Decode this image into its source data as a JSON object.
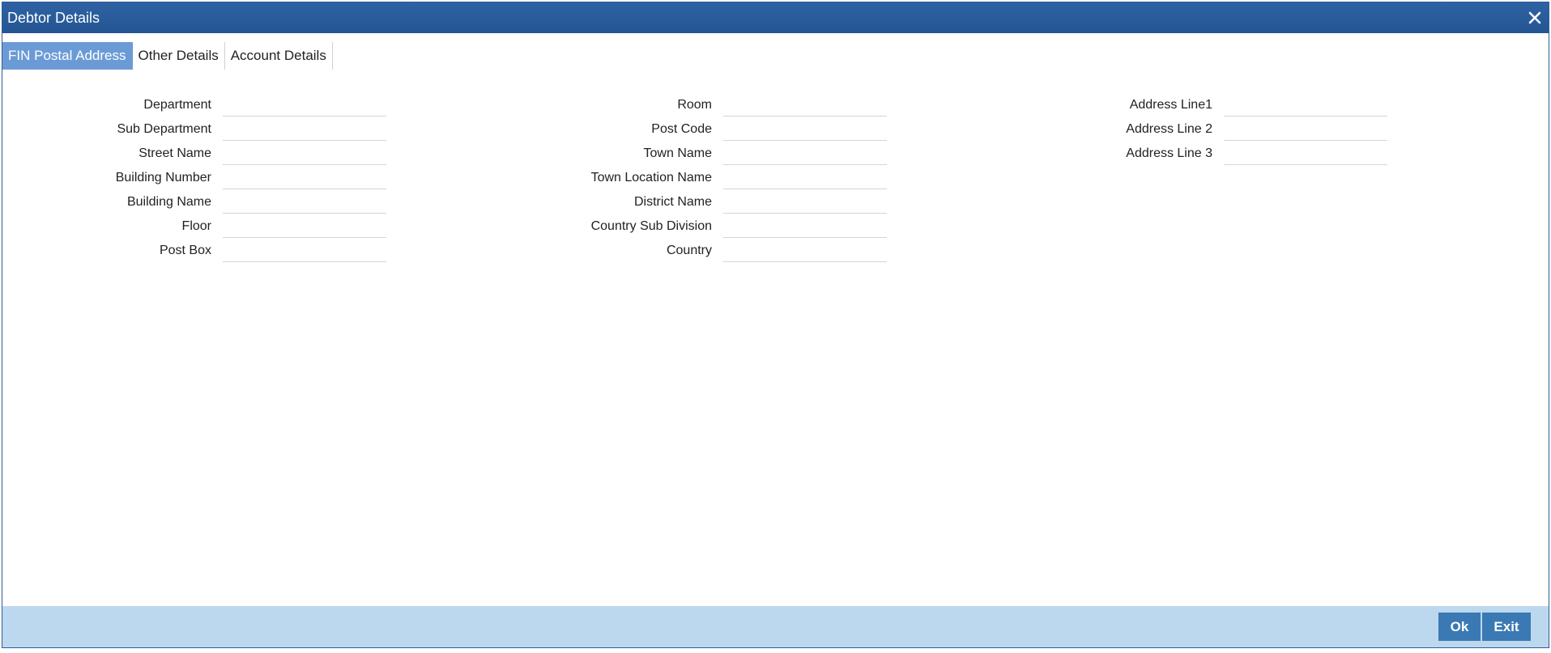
{
  "window": {
    "title": "Debtor Details",
    "close_icon": "close-icon"
  },
  "tabs": [
    {
      "label": "FIN Postal Address",
      "active": true
    },
    {
      "label": "Other Details",
      "active": false
    },
    {
      "label": "Account Details",
      "active": false
    }
  ],
  "form": {
    "column1": [
      {
        "label": "Department",
        "value": ""
      },
      {
        "label": "Sub Department",
        "value": ""
      },
      {
        "label": "Street Name",
        "value": ""
      },
      {
        "label": "Building Number",
        "value": ""
      },
      {
        "label": "Building Name",
        "value": ""
      },
      {
        "label": "Floor",
        "value": ""
      },
      {
        "label": "Post Box",
        "value": ""
      }
    ],
    "column2": [
      {
        "label": "Room",
        "value": ""
      },
      {
        "label": "Post Code",
        "value": ""
      },
      {
        "label": "Town Name",
        "value": ""
      },
      {
        "label": "Town Location Name",
        "value": ""
      },
      {
        "label": "District Name",
        "value": ""
      },
      {
        "label": "Country Sub Division",
        "value": ""
      },
      {
        "label": "Country",
        "value": ""
      }
    ],
    "column3": [
      {
        "label": "Address Line1",
        "value": ""
      },
      {
        "label": "Address Line 2",
        "value": ""
      },
      {
        "label": "Address Line 3",
        "value": ""
      }
    ]
  },
  "footer": {
    "ok_label": "Ok",
    "exit_label": "Exit"
  },
  "colors": {
    "titlebar": "#2a5c9c",
    "active_tab": "#6b9bd6",
    "footer": "#bcd8ee",
    "button": "#3b79b5"
  }
}
